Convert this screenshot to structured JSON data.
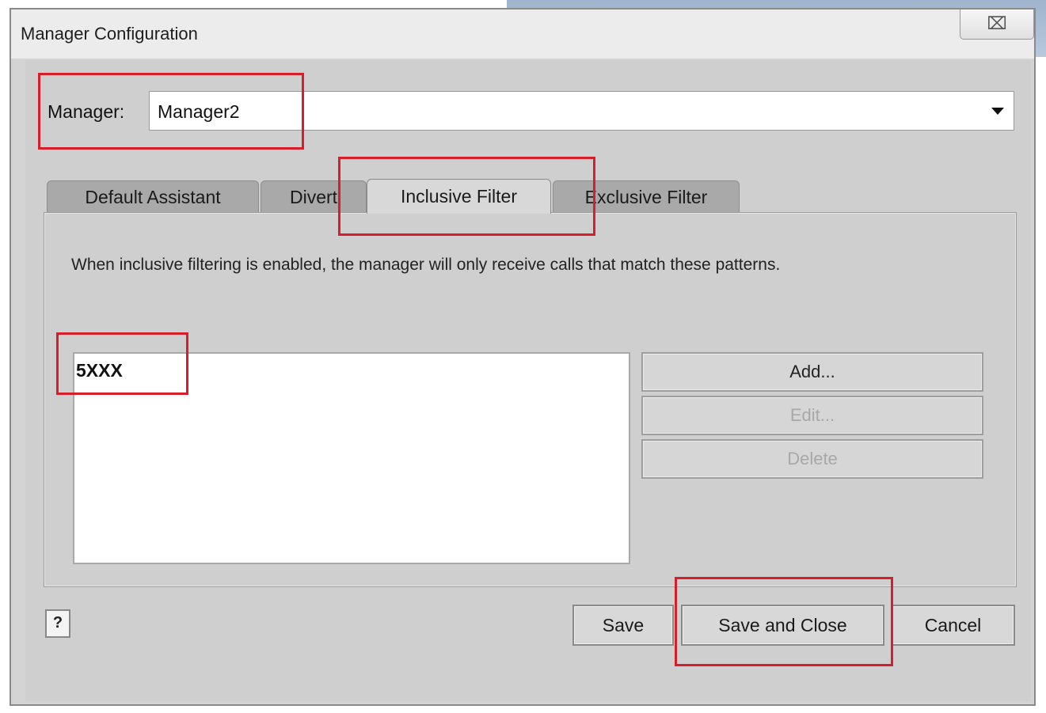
{
  "window": {
    "title": "Manager Configuration",
    "close_glyph": "⌧"
  },
  "manager": {
    "label": "Manager:",
    "selected": "Manager2"
  },
  "tabs": [
    {
      "label": "Default Assistant",
      "active": false
    },
    {
      "label": "Divert",
      "active": false
    },
    {
      "label": "Inclusive Filter",
      "active": true
    },
    {
      "label": "Exclusive Filter",
      "active": false
    }
  ],
  "inclusive_filter": {
    "description": "When inclusive filtering is enabled, the manager will only receive calls that match these patterns.",
    "patterns": [
      "5XXX"
    ],
    "buttons": {
      "add": "Add...",
      "edit": "Edit...",
      "delete": "Delete"
    }
  },
  "footer": {
    "help": "?",
    "save": "Save",
    "save_and_close": "Save and Close",
    "cancel": "Cancel"
  },
  "colors": {
    "annotation": "#d61f2b"
  }
}
